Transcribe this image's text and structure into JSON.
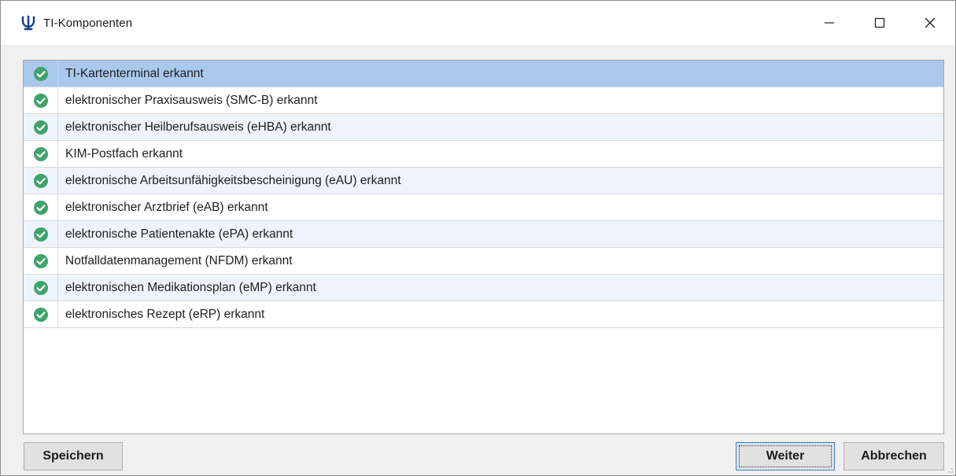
{
  "window": {
    "title": "TI-Komponenten",
    "app_icon": "psi-icon",
    "controls": [
      "minimize-icon",
      "maximize-icon",
      "close-icon"
    ]
  },
  "status_list": {
    "selected_index": 0,
    "status_icon": "check-circle-icon",
    "status_color": "#3fa36b",
    "items": [
      {
        "label": "TI-Kartenterminal erkannt"
      },
      {
        "label": "elektronischer Praxisausweis (SMC-B) erkannt"
      },
      {
        "label": "elektronischer Heilberufsausweis (eHBA) erkannt"
      },
      {
        "label": "KIM-Postfach erkannt"
      },
      {
        "label": "elektronische Arbeitsunfähigkeitsbescheinigung (eAU) erkannt"
      },
      {
        "label": "elektronischer Arztbrief (eAB) erkannt"
      },
      {
        "label": "elektronische Patientenakte (ePA) erkannt"
      },
      {
        "label": "Notfalldatenmanagement (NFDM) erkannt"
      },
      {
        "label": "elektronischen Medikationsplan (eMP) erkannt"
      },
      {
        "label": "elektronisches Rezept (eRP) erkannt"
      }
    ]
  },
  "buttons": {
    "save_label": "Speichern",
    "next_label": "Weiter",
    "cancel_label": "Abbrechen"
  },
  "colors": {
    "selection": "#a9c8ec",
    "alt_row": "#eef4fc",
    "brand": "#0b3d91"
  }
}
